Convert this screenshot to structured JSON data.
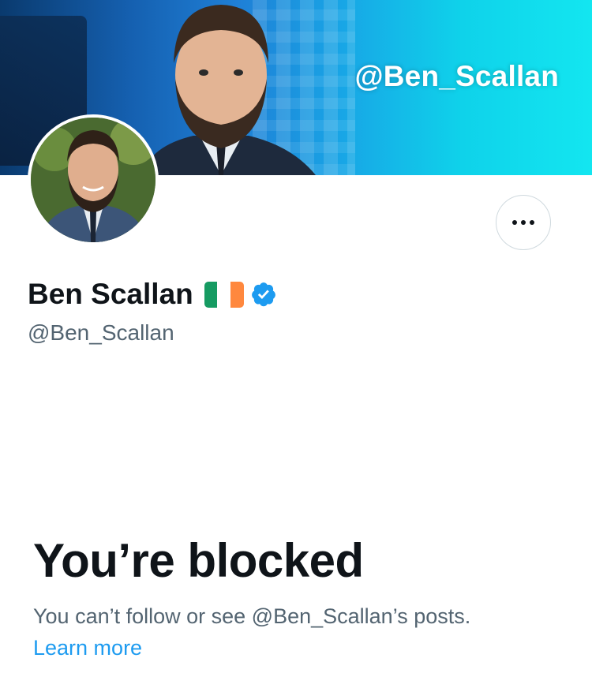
{
  "banner": {
    "handle_text": "@Ben_Scallan",
    "gradient_start": "#0a3a6e",
    "gradient_end": "#13e6f0"
  },
  "profile": {
    "display_name": "Ben Scallan",
    "handle": "@Ben_Scallan",
    "flag_icon": "irish-flag-icon",
    "flag_colors": [
      "#169b62",
      "#ffffff",
      "#ff883e"
    ],
    "verified_icon": "verified-badge-icon",
    "verified_color": "#1d9bf0",
    "more_icon": "more-options-icon"
  },
  "blocked": {
    "title": "You’re blocked",
    "description": "You can’t follow or see @Ben_Scallan’s posts.",
    "link_label": "Learn more",
    "link_color": "#1d9bf0"
  }
}
